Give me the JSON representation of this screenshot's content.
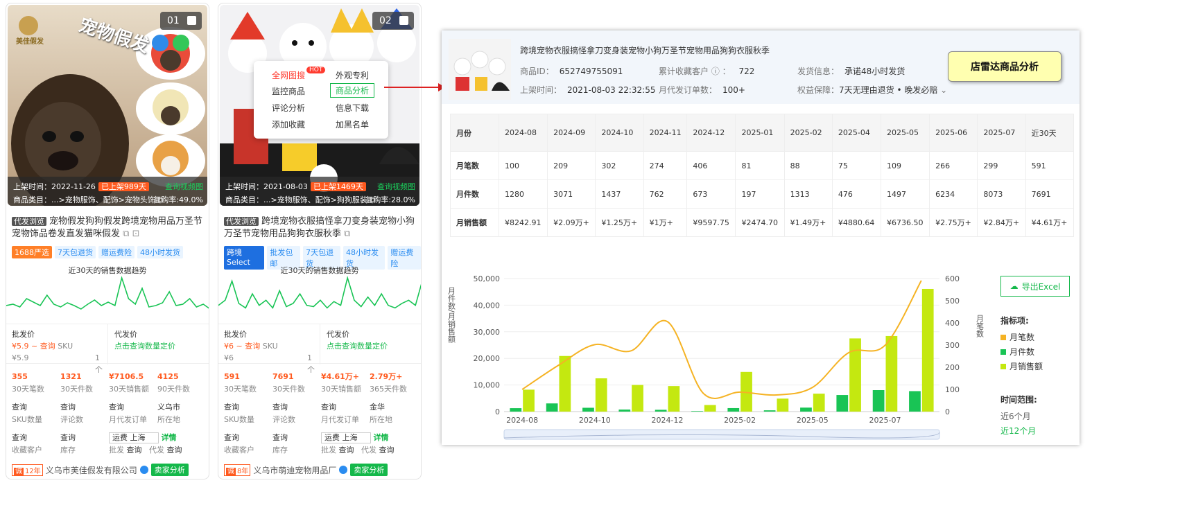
{
  "cards": [
    {
      "num": "01",
      "image_caption": "宠物假发",
      "logo_text": "美佳假发",
      "listed_label": "上架时间：",
      "listed_date": "2022-11-26",
      "listed_badge": "已上架989天",
      "video_link": "查询视频图",
      "category_label": "商品类目：",
      "category_path": "...>宠物服饰、配饰>宠物头饰",
      "repurchase": "复购率:49.0%",
      "tag": "代发浏览",
      "title": "宠物假发狗狗假发跨境宠物用品万圣节宠物饰品卷发直发猫咪假发",
      "tags": [
        "1688严选",
        "7天包退货",
        "赠运费险",
        "48小时发货"
      ],
      "trend_title": "近30天的销售数据趋势",
      "wholesale_label": "批发价",
      "wholesale_value": "¥5.9 ~ 查询",
      "sku_label": "SKU",
      "dropship_label": "代发价",
      "dropship_link": "点击查询数量定价",
      "price_line": "¥5.9",
      "qty_line": "1 个",
      "stats_row1": [
        {
          "v": "355",
          "l": "30天笔数"
        },
        {
          "v": "1321",
          "l": "30天件数"
        },
        {
          "v": "¥7106.5",
          "l": "30天销售额"
        },
        {
          "v": "4125",
          "l": "90天件数"
        }
      ],
      "stats_row2": [
        {
          "v": "查询",
          "l": "SKU数量"
        },
        {
          "v": "查询",
          "l": "评论数"
        },
        {
          "v": "查询",
          "l": "月代发订单"
        },
        {
          "v": "义乌市",
          "l": "所在地"
        }
      ],
      "stats_row3": [
        {
          "v": "查询",
          "l": "收藏客户"
        },
        {
          "v": "查询",
          "l": "库存"
        }
      ],
      "ship_text": "运费 上海",
      "detail_link": "详情",
      "wholesale_q_label": "批发",
      "wholesale_q": "查询",
      "dropship_q_label": "代发",
      "dropship_q": "查询",
      "seller_years": "12年",
      "seller_cheng": "诚",
      "seller_name": "义乌市芙佳假发有限公司",
      "seller_btn": "卖家分析",
      "spark": [
        20,
        22,
        18,
        30,
        25,
        20,
        35,
        22,
        18,
        24,
        20,
        15,
        22,
        28,
        20,
        25,
        20,
        60,
        30,
        22,
        45,
        18,
        20,
        24,
        40,
        20,
        22,
        30,
        18,
        22,
        15
      ]
    },
    {
      "num": "02",
      "listed_label": "上架时间：",
      "listed_date": "2021-08-03",
      "listed_badge": "已上架1469天",
      "video_link": "查询视频图",
      "category_label": "商品类目：",
      "category_path": "...>宠物服饰、配饰>狗狗服装",
      "repurchase": "复购率:28.0%",
      "tag": "代发浏览",
      "title": "跨境宠物衣服搞怪拿刀变身装宠物小狗万圣节宠物用品狗狗衣服秋季",
      "tags": [
        "跨境Select",
        "批发包邮",
        "7天包退货",
        "48小时发货",
        "赠运费险"
      ],
      "trend_title": "近30天的销售数据趋势",
      "wholesale_label": "批发价",
      "wholesale_value": "¥6 ~ 查询",
      "sku_label": "SKU",
      "dropship_label": "代发价",
      "dropship_link": "点击查询数量定价",
      "price_line": "¥6",
      "qty_line": "1 个",
      "stats_row1": [
        {
          "v": "591",
          "l": "30天笔数"
        },
        {
          "v": "7691",
          "l": "30天件数"
        },
        {
          "v": "¥4.61万+",
          "l": "30天销售额"
        },
        {
          "v": "2.79万+",
          "l": "365天件数"
        }
      ],
      "stats_row2": [
        {
          "v": "查询",
          "l": "SKU数量"
        },
        {
          "v": "查询",
          "l": "评论数"
        },
        {
          "v": "查询",
          "l": "月代发订单"
        },
        {
          "v": "金华",
          "l": "所在地"
        }
      ],
      "stats_row3": [
        {
          "v": "查询",
          "l": "收藏客户"
        },
        {
          "v": "查询",
          "l": "库存"
        }
      ],
      "ship_text": "运费 上海",
      "detail_link": "详情",
      "wholesale_q_label": "批发",
      "wholesale_q": "查询",
      "dropship_q_label": "代发",
      "dropship_q": "查询",
      "seller_years": "8年",
      "seller_cheng": "诚",
      "seller_name": "义乌市萌迪宠物用品厂",
      "seller_btn": "卖家分析",
      "spark": [
        22,
        30,
        60,
        25,
        18,
        40,
        22,
        30,
        18,
        45,
        20,
        25,
        40,
        22,
        20,
        30,
        18,
        28,
        22,
        65,
        30,
        20,
        35,
        22,
        40,
        22,
        18,
        25,
        30,
        22,
        60
      ]
    }
  ],
  "context_menu": {
    "items": [
      "全网图搜",
      "外观专利",
      "监控商品",
      "商品分析",
      "评论分析",
      "信息下载",
      "添加收藏",
      "加黑名单"
    ],
    "hot": "HOT"
  },
  "panel": {
    "title": "跨境宠物衣服搞怪拿刀变身装宠物小狗万圣节宠物用品狗狗衣服秋季",
    "product_id_label": "商品ID：",
    "product_id": "652749755091",
    "fav_label": "累计收藏客户",
    "fav_value": "722",
    "ship_label": "发货信息：",
    "ship_value": "承诺48小时发货",
    "listed_label": "上架时间：",
    "listed_value": "2021-08-03 22:32:55",
    "dropship_label": "月代发订单数：",
    "dropship_value": "100+",
    "rights_label": "权益保障：",
    "rights_value": "7天无理由退货 • 晚发必赔",
    "radar_label": "店雷达商品分析",
    "table": {
      "header": [
        "月份",
        "2024-08",
        "2024-09",
        "2024-10",
        "2024-11",
        "2024-12",
        "2025-01",
        "2025-02",
        "2025-04",
        "2025-05",
        "2025-06",
        "2025-07",
        "近30天"
      ],
      "rows": [
        [
          "月笔数",
          "100",
          "209",
          "302",
          "274",
          "406",
          "81",
          "88",
          "75",
          "109",
          "266",
          "299",
          "591"
        ],
        [
          "月件数",
          "1280",
          "3071",
          "1437",
          "762",
          "673",
          "197",
          "1313",
          "476",
          "1497",
          "6234",
          "8073",
          "7691"
        ],
        [
          "月销售额",
          "¥8242.91",
          "¥2.09万+",
          "¥1.25万+",
          "¥1万+",
          "¥9597.75",
          "¥2474.70",
          "¥1.49万+",
          "¥4880.64",
          "¥6736.50",
          "¥2.75万+",
          "¥2.84万+",
          "¥4.61万+"
        ]
      ]
    },
    "export_label": "导出Excel",
    "metrics_title": "指标项:",
    "metrics": [
      "月笔数",
      "月件数",
      "月销售额"
    ],
    "range_title": "时间范围:",
    "ranges": [
      "近6个月",
      "近12个月"
    ],
    "colors": {
      "orders": "#f5b324",
      "pieces": "#19c455",
      "sales": "#c4e810",
      "accent": "#14b84a"
    }
  },
  "chart_data": {
    "type": "bar",
    "categories": [
      "2024-08",
      "2024-09",
      "2024-10",
      "2024-11",
      "2024-12",
      "2025-01",
      "2025-02",
      "2025-04",
      "2025-05",
      "2025-06",
      "2025-07",
      "近30天"
    ],
    "x_tick_labels": [
      "2024-08",
      "2024-10",
      "2024-12",
      "2025-02",
      "2025-05",
      "2025-07"
    ],
    "series": [
      {
        "name": "月件数",
        "axis": "left",
        "values": [
          1280,
          3071,
          1437,
          762,
          673,
          197,
          1313,
          476,
          1497,
          6234,
          8073,
          7691
        ]
      },
      {
        "name": "月销售额",
        "axis": "left",
        "values": [
          8242.91,
          20900,
          12500,
          10000,
          9597.75,
          2474.7,
          14900,
          4880.64,
          6736.5,
          27500,
          28400,
          46100
        ]
      },
      {
        "name": "月笔数",
        "axis": "right",
        "type": "line",
        "values": [
          100,
          209,
          302,
          274,
          406,
          81,
          88,
          75,
          109,
          266,
          299,
          591
        ]
      }
    ],
    "ylabel": "月件数/月销售额",
    "y2label": "月笔数",
    "ylim": [
      0,
      50000
    ],
    "y2lim": [
      0,
      600
    ],
    "yticks": [
      "0",
      "10,000",
      "20,000",
      "30,000",
      "40,000",
      "50,000"
    ],
    "y2ticks": [
      "0",
      "100",
      "200",
      "300",
      "400",
      "500",
      "600"
    ],
    "grid": true
  }
}
